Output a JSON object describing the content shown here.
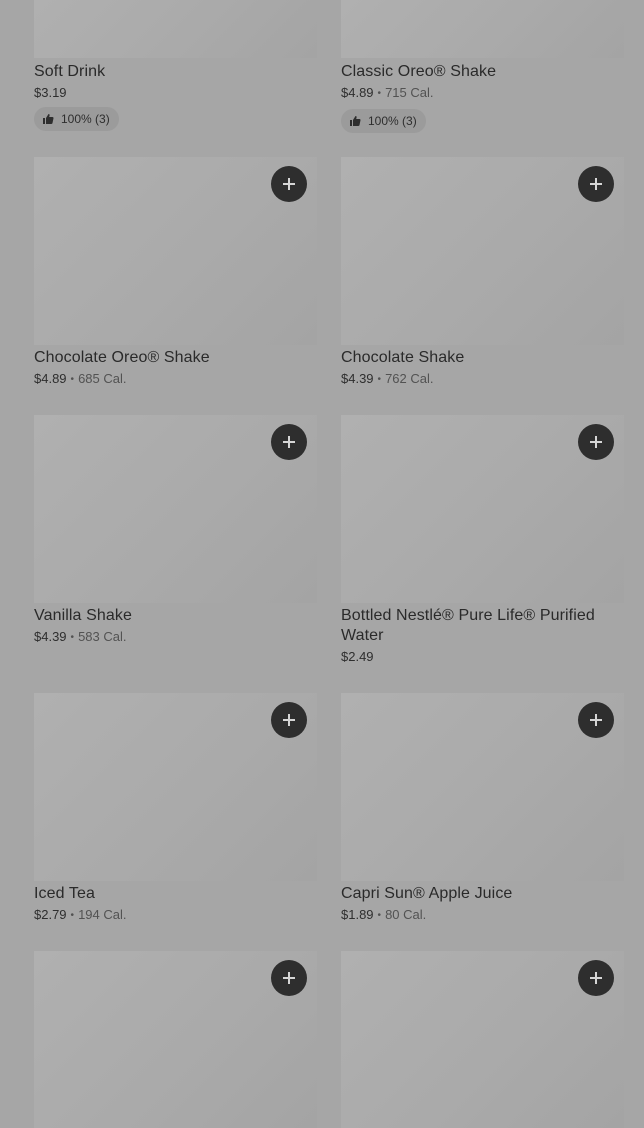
{
  "items": [
    {
      "name": "Soft Drink",
      "price": "$3.19",
      "calories": "",
      "rating": "100% (3)"
    },
    {
      "name": "Classic Oreo® Shake",
      "price": "$4.89",
      "calories": "715 Cal.",
      "rating": "100% (3)"
    },
    {
      "name": "Chocolate Oreo® Shake",
      "price": "$4.89",
      "calories": "685 Cal.",
      "rating": ""
    },
    {
      "name": "Chocolate Shake",
      "price": "$4.39",
      "calories": "762 Cal.",
      "rating": ""
    },
    {
      "name": "Vanilla Shake",
      "price": "$4.39",
      "calories": "583 Cal.",
      "rating": ""
    },
    {
      "name": "Bottled Nestlé® Pure Life® Purified Water",
      "price": "$2.49",
      "calories": "",
      "rating": ""
    },
    {
      "name": "Iced Tea",
      "price": "$2.79",
      "calories": "194 Cal.",
      "rating": ""
    },
    {
      "name": "Capri Sun® Apple Juice",
      "price": "$1.89",
      "calories": "80 Cal.",
      "rating": ""
    }
  ],
  "separator": "•",
  "icons": {
    "add": "plus-icon",
    "rating": "thumbs-up-icon"
  },
  "colors": {
    "overlay_background": "#a6a6a6",
    "add_button": "#2e2e2e"
  }
}
